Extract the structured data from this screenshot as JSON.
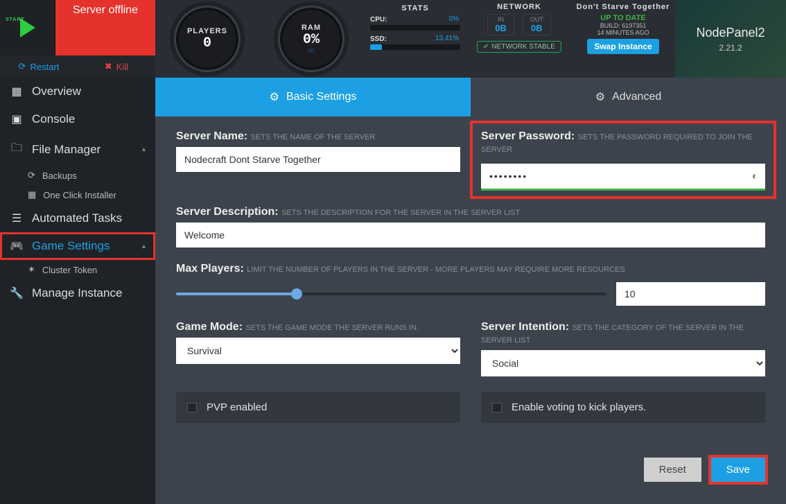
{
  "header": {
    "start_label": "START",
    "server_status": "Server offline",
    "restart": "Restart",
    "kill": "Kill",
    "players_title": "PLAYERS",
    "players_val": "0",
    "ram_title": "RAM",
    "ram_val": "0%",
    "ram_sub": "0B",
    "stats_title": "STATS",
    "cpu_label": "CPU:",
    "cpu_pct": "0%",
    "ssd_label": "SSD:",
    "ssd_pct": "13.41%",
    "net_title": "NETWORK",
    "net_in_label": "IN",
    "net_in_val": "0B",
    "net_out_label": "OUT",
    "net_out_val": "0B",
    "net_stable": "NETWORK STABLE",
    "game_title": "Don't Starve Together",
    "uptodate": "UP TO DATE",
    "build": "BUILD:  6197351",
    "build_time": "14 MINUTES AGO",
    "swap": "Swap Instance",
    "brand": "NodePanel2",
    "brand_ver": "2.21.2"
  },
  "sidebar": {
    "overview": "Overview",
    "console": "Console",
    "file_manager": "File Manager",
    "backups": "Backups",
    "one_click": "One Click Installer",
    "automated": "Automated Tasks",
    "game_settings": "Game Settings",
    "cluster_token": "Cluster Token",
    "manage_instance": "Manage Instance"
  },
  "tabs": {
    "basic": "Basic Settings",
    "advanced": "Advanced"
  },
  "form": {
    "server_name_label": "Server Name:",
    "server_name_hint": "SETS THE NAME OF THE SERVER",
    "server_name_val": "Nodecraft Dont Starve Together",
    "password_label": "Server Password:",
    "password_hint": "SETS THE PASSWORD REQUIRED TO JOIN THE SERVER",
    "password_val": "••••••••",
    "desc_label": "Server Description:",
    "desc_hint": "SETS THE DESCRIPTION FOR THE SERVER IN THE SERVER LIST",
    "desc_val": "Welcome",
    "max_label": "Max Players:",
    "max_hint": "LIMIT THE NUMBER OF PLAYERS IN THE SERVER - MORE PLAYERS MAY REQUIRE MORE RESOURCES",
    "max_val": "10",
    "mode_label": "Game Mode:",
    "mode_hint": "SETS THE GAME MODE THE SERVER RUNS IN.",
    "mode_val": "Survival",
    "intention_label": "Server Intention:",
    "intention_hint": "SETS THE CATEGORY OF THE SERVER IN THE SERVER LIST",
    "intention_val": "Social",
    "pvp_label": "PVP enabled",
    "vote_label": "Enable voting to kick players.",
    "reset": "Reset",
    "save": "Save"
  }
}
